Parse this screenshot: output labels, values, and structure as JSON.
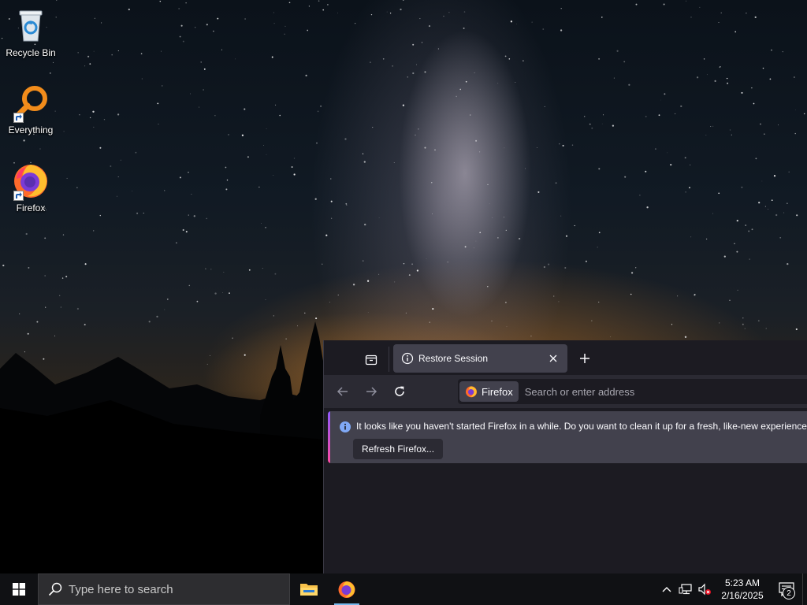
{
  "desktop": {
    "icons": [
      {
        "label": "Recycle Bin",
        "icon": "recycle-bin-icon"
      },
      {
        "label": "Everything",
        "icon": "everything-search-icon"
      },
      {
        "label": "Firefox",
        "icon": "firefox-icon"
      }
    ]
  },
  "firefox": {
    "tab": {
      "title": "Restore Session"
    },
    "urlbar": {
      "identity_label": "Firefox",
      "placeholder": "Search or enter address"
    },
    "notification": {
      "message": "It looks like you haven't started Firefox in a while. Do you want to clean it up for a fresh, like-new experience?",
      "button_label": "Refresh Firefox..."
    }
  },
  "taskbar": {
    "search_placeholder": "Type here to search",
    "clock": {
      "time": "5:23 AM",
      "date": "2/16/2025"
    },
    "notification_count": "2"
  },
  "colors": {
    "accent": "#9059ff",
    "taskbar": "#101114",
    "firefox_frame": "#1c1b22",
    "firefox_toolbar": "#2b2a33"
  }
}
